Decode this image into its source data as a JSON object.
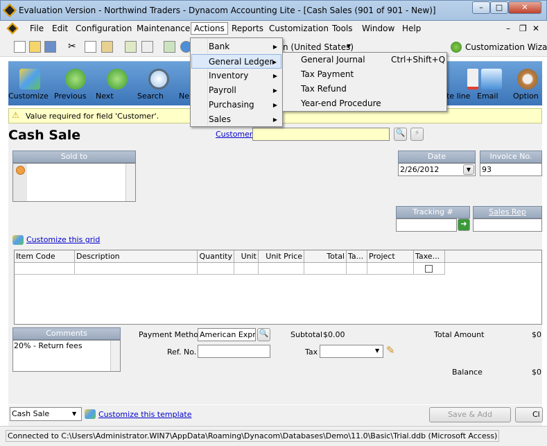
{
  "window": {
    "title": "Evaluation Version - Northwind Traders - Dynacom Accounting Lite - [Cash Sales (901 of 901 - New)]",
    "minimize": "–",
    "maximize": "□",
    "close": "✕",
    "doc_min": "–",
    "doc_restore": "❐",
    "doc_close": "✕"
  },
  "menu": [
    "File",
    "Edit",
    "Configuration",
    "Maintenance",
    "Actions",
    "Reports",
    "Customization",
    "Tools",
    "Window",
    "Help"
  ],
  "toolbar": {
    "locale": "n (United States)",
    "wizard": "Customization Wizard"
  },
  "ribbon": {
    "customize": "Customize",
    "previous": "Previous",
    "next": "Next",
    "search": "Search",
    "ne": "Ne",
    "delete_line": "te line",
    "email": "Email",
    "options": "Option"
  },
  "warning": "Value required for field 'Customer'.",
  "form": {
    "title": "Cash Sale",
    "customer_label": "Customer",
    "customer_value": "",
    "sold_to": "Sold to",
    "date_label": "Date",
    "date_value": "2/26/2012",
    "invoice_label": "Invoice No.",
    "invoice_value": "93",
    "tracking_label": "Tracking #",
    "sales_rep_label": "Sales Rep",
    "customize_grid": "Customize this grid"
  },
  "grid": {
    "columns": [
      "Item Code",
      "Description",
      "Quantity",
      "Unit",
      "Unit Price",
      "Total",
      "Ta...",
      "Project",
      "Taxe..."
    ]
  },
  "totals": {
    "comments_label": "Comments",
    "comments_value": "20% - Return fees",
    "payment_method_label": "Payment Method",
    "payment_method_value": "American Expres",
    "ref_label": "Ref. No.",
    "subtotal_label": "Subtotal",
    "subtotal_value": "$0.00",
    "tax_label": "Tax",
    "total_amount_label": "Total Amount",
    "total_amount_value": "$0",
    "balance_label": "Balance",
    "balance_value": "$0"
  },
  "bottom": {
    "template": "Cash Sale",
    "customize_template": "Customize this template",
    "save_add": "Save & Add",
    "close": "Cl"
  },
  "status": "Connected to C:\\Users\\Administrator.WIN7\\AppData\\Roaming\\Dynacom\\Databases\\Demo\\11.0\\Basic\\Trial.ddb (Microsoft Access)",
  "actions_menu": [
    "Bank",
    "General Ledger",
    "Inventory",
    "Payroll",
    "Purchasing",
    "Sales"
  ],
  "gl_menu": [
    {
      "label": "General Journal",
      "shortcut": "Ctrl+Shift+Q"
    },
    {
      "label": "Tax Payment",
      "shortcut": ""
    },
    {
      "label": "Tax Refund",
      "shortcut": ""
    },
    {
      "label": "Year-end Procedure",
      "shortcut": ""
    }
  ],
  "colors": {
    "ribbon": "#4a84c4",
    "warn": "#ffffc8",
    "header": "#a8b6c8",
    "link": "#0000cc"
  }
}
